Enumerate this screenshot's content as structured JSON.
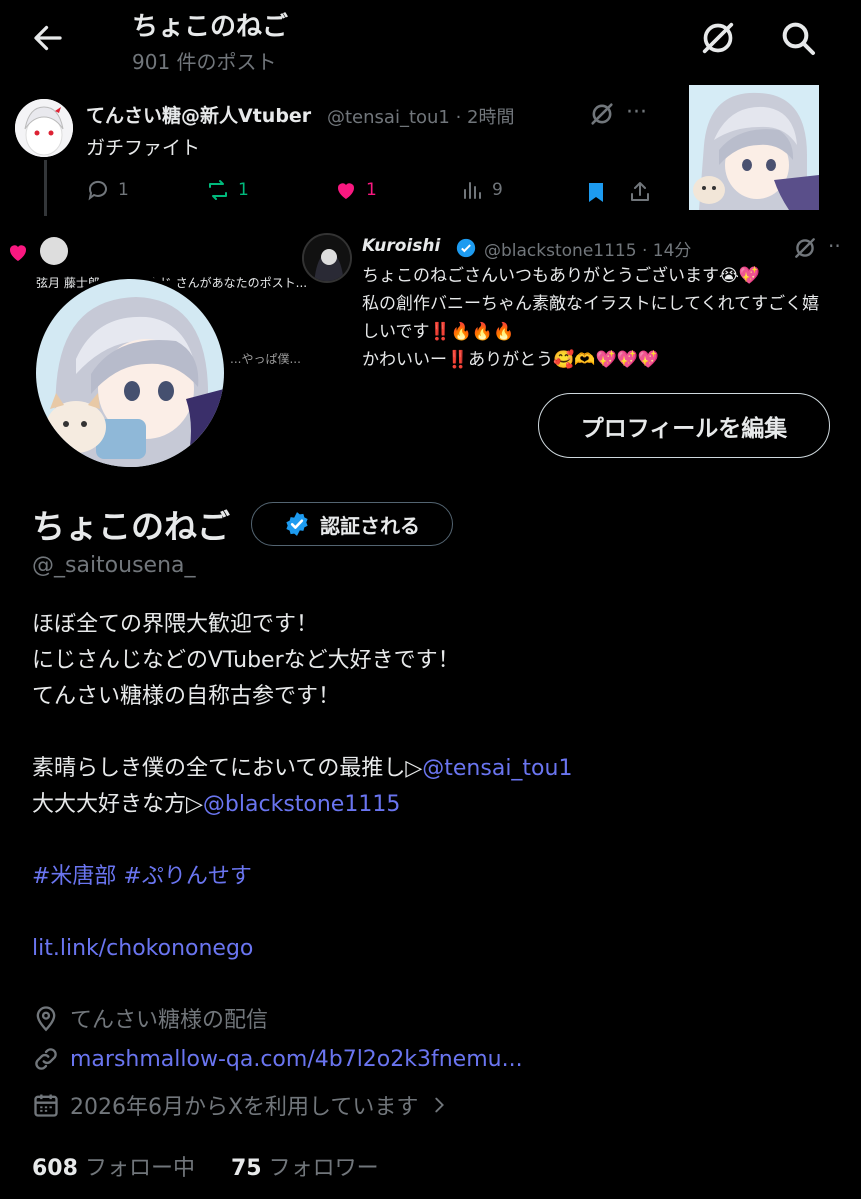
{
  "header": {
    "title": "ちょこのねご",
    "post_count": "901 件のポスト"
  },
  "banner_tweet": {
    "name": "てんさい糖@新人Vtuber",
    "meta": "@tensai_tou1 · 2時間",
    "text": "ガチファイト",
    "reply_count": "1",
    "repost_count": "1",
    "like_count": "1",
    "view_count": "9"
  },
  "banner_notification": {
    "text": "弦月 藤士郎、にじさんじ さんがあなたのポスト...",
    "preview": "...やっぱ僕..."
  },
  "banner_reply": {
    "name": "Kuroishi",
    "meta": "@blackstone1115 · 14分",
    "line1": "ちょこのねごさんいつもありがとうございます😭💖",
    "line2": "私の創作バニーちゃん素敵なイラストにしてくれてすごく嬉",
    "line3": "しいです‼️🔥🔥🔥",
    "line4": "かわいいー‼️ありがとう🥰🫶💖💖💖"
  },
  "profile": {
    "edit_button": "プロフィールを編集",
    "name": "ちょこのねご",
    "verify_label": "認証される",
    "handle": "@_saitousena_",
    "bio": {
      "line1": "ほぼ全ての界隈大歓迎です！",
      "line2": "にじさんじなどのVTuberなど大好きです！",
      "line3": "てんさい糖様の自称古参です！",
      "line4_text": "素晴らしき僕の全てにおいての最推し▷",
      "line4_link": "@tensai_tou1",
      "line5_text": "大大大好きな方▷",
      "line5_link": "@blackstone1115",
      "hashtags": "#米唐部 #ぷりんせす",
      "url": "lit.link/chokononego"
    },
    "location": "てんさい糖様の配信",
    "website": "marshmallow-qa.com/4b7l2o2k3fnemu...",
    "joined": "2026年6月からXを利用しています",
    "following_count": "608",
    "following_label": "フォロー中",
    "followers_count": "75",
    "followers_label": "フォロワー"
  },
  "colors": {
    "background": "#000000",
    "text": "#e7e9ea",
    "muted": "#71767b",
    "link": "#6a75f0",
    "like": "#f91880",
    "repost": "#00ba7c",
    "bookmark": "#1d9bf0",
    "verified": "#1d9bf0"
  }
}
